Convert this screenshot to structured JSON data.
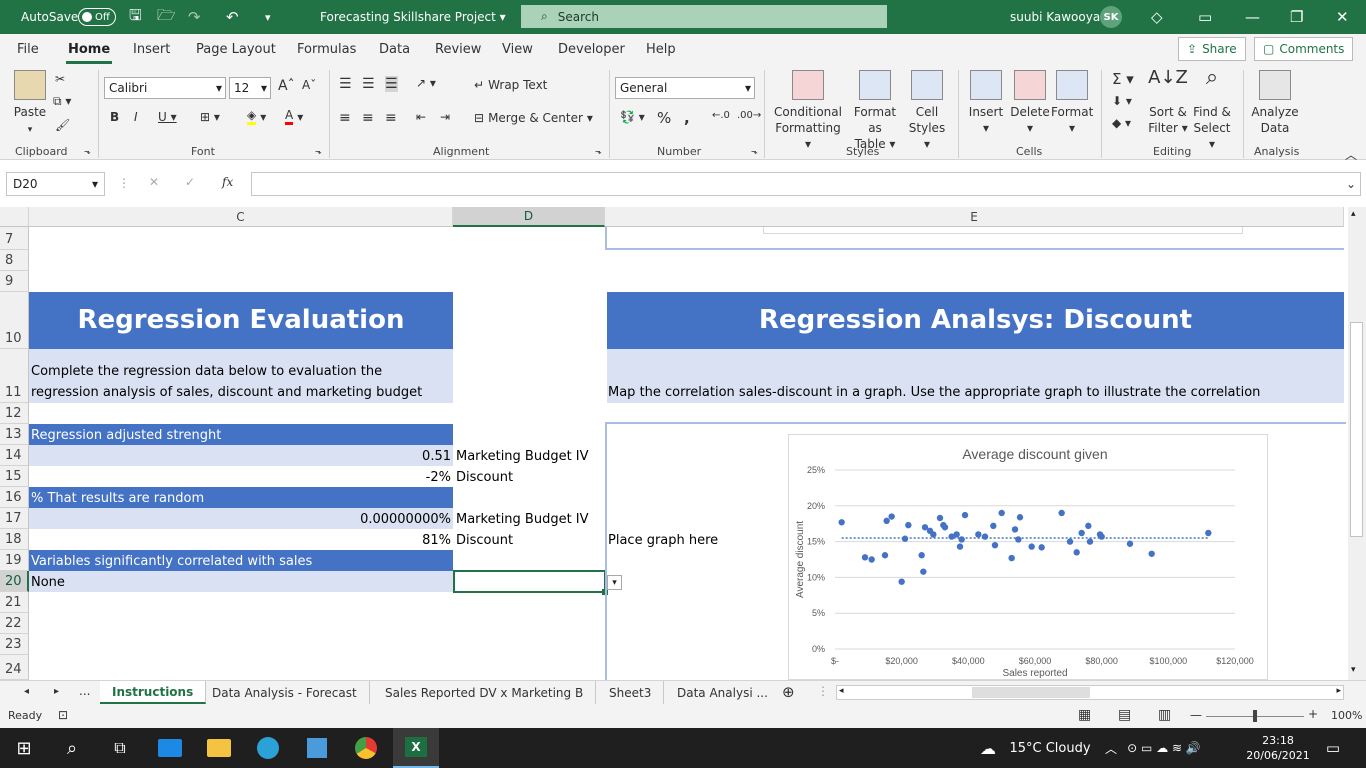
{
  "titlebar": {
    "autosave_label": "AutoSave",
    "autosave_state": "Off",
    "title": "Forecasting Skillshare Project",
    "search_placeholder": "Search",
    "user_name": "suubi Kawooya",
    "user_initials": "SK"
  },
  "ribbon_tabs": [
    "File",
    "Home",
    "Insert",
    "Page Layout",
    "Formulas",
    "Data",
    "Review",
    "View",
    "Developer",
    "Help"
  ],
  "active_tab": "Home",
  "share_label": "Share",
  "comments_label": "Comments",
  "ribbon": {
    "paste": "Paste",
    "font_name": "Calibri",
    "font_size": "12",
    "wrap_text": "Wrap Text",
    "merge_center": "Merge & Center",
    "number_format": "General",
    "conditional_formatting": [
      "Conditional",
      "Formatting"
    ],
    "format_as_table": [
      "Format as",
      "Table"
    ],
    "cell_styles": [
      "Cell",
      "Styles"
    ],
    "insert": "Insert",
    "delete": "Delete",
    "format": "Format",
    "sort_filter": [
      "Sort &",
      "Filter"
    ],
    "find_select": [
      "Find &",
      "Select"
    ],
    "analyze_data": [
      "Analyze",
      "Data"
    ],
    "groups": [
      "Clipboard",
      "Font",
      "Alignment",
      "Number",
      "Styles",
      "Cells",
      "Editing",
      "Analysis"
    ]
  },
  "formula_bar": {
    "name_box": "D20",
    "fx": "fx",
    "formula": ""
  },
  "columns": [
    "C",
    "D",
    "E"
  ],
  "rows": [
    "7",
    "8",
    "9",
    "10",
    "11",
    "12",
    "13",
    "14",
    "15",
    "16",
    "17",
    "18",
    "19",
    "20",
    "21",
    "22",
    "23",
    "24"
  ],
  "sheet": {
    "left_title": "Regression Evaluation",
    "left_desc_line1": "Complete the regression data below to evaluation the",
    "left_desc_line2": "regression analysis of sales, discount and marketing budget",
    "right_title": "Regression Analsys: Discount",
    "right_desc": "Map the correlation sales-discount in a graph. Use the appropriate graph to illustrate the correlation",
    "r13": "Regression adjusted strenght",
    "r14_val": "0.51",
    "r14_label": "Marketing Budget IV",
    "r15_val": "-2%",
    "r15_label": "Discount",
    "r16": "% That results are random",
    "r17_val": "0.00000000%",
    "r17_label": "Marketing Budget IV",
    "r18_val": "81%",
    "r18_label": "Discount",
    "r19": "Variables significantly correlated with sales",
    "r20": "None",
    "place_graph": "Place graph here"
  },
  "chart_data": {
    "type": "scatter",
    "title": "Average discount given",
    "xlabel": "Sales reported",
    "ylabel": "Average discount",
    "x_ticks": [
      "$-",
      "$20,000",
      "$40,000",
      "$60,000",
      "$80,000",
      "$100,000",
      "$120,000"
    ],
    "y_ticks": [
      "0%",
      "5%",
      "10%",
      "15%",
      "20%",
      "25%"
    ],
    "xlim": [
      0,
      120000
    ],
    "ylim": [
      0,
      0.25
    ],
    "trendline": "linear-dotted",
    "trendline_y": 0.155,
    "color": "#4472c4",
    "points": [
      [
        2000,
        0.177
      ],
      [
        9000,
        0.128
      ],
      [
        11000,
        0.125
      ],
      [
        15000,
        0.131
      ],
      [
        15500,
        0.179
      ],
      [
        17000,
        0.185
      ],
      [
        20000,
        0.094
      ],
      [
        21000,
        0.154
      ],
      [
        22000,
        0.173
      ],
      [
        26000,
        0.131
      ],
      [
        26500,
        0.108
      ],
      [
        27000,
        0.17
      ],
      [
        28500,
        0.165
      ],
      [
        29500,
        0.16
      ],
      [
        31500,
        0.183
      ],
      [
        32500,
        0.173
      ],
      [
        33000,
        0.17
      ],
      [
        35000,
        0.157
      ],
      [
        36500,
        0.16
      ],
      [
        37500,
        0.143
      ],
      [
        38000,
        0.153
      ],
      [
        39000,
        0.187
      ],
      [
        43000,
        0.16
      ],
      [
        45000,
        0.157
      ],
      [
        47500,
        0.172
      ],
      [
        48000,
        0.145
      ],
      [
        50000,
        0.19
      ],
      [
        53000,
        0.127
      ],
      [
        54000,
        0.167
      ],
      [
        55000,
        0.153
      ],
      [
        55500,
        0.184
      ],
      [
        59000,
        0.143
      ],
      [
        62000,
        0.142
      ],
      [
        68000,
        0.19
      ],
      [
        70500,
        0.15
      ],
      [
        72500,
        0.135
      ],
      [
        74000,
        0.162
      ],
      [
        76000,
        0.172
      ],
      [
        76500,
        0.15
      ],
      [
        79500,
        0.16
      ],
      [
        80000,
        0.157
      ],
      [
        88500,
        0.147
      ],
      [
        95000,
        0.133
      ],
      [
        112000,
        0.162
      ]
    ]
  },
  "sheet_tabs": [
    "Instructions",
    "Data Analysis - Forecast",
    "Sales Reported DV x Marketing B",
    "Sheet3",
    "Data Analysi ..."
  ],
  "active_sheet": "Instructions",
  "status": {
    "ready": "Ready",
    "zoom": "100%"
  },
  "taskbar": {
    "weather": "15°C  Cloudy",
    "time": "23:18",
    "date": "20/06/2021"
  }
}
